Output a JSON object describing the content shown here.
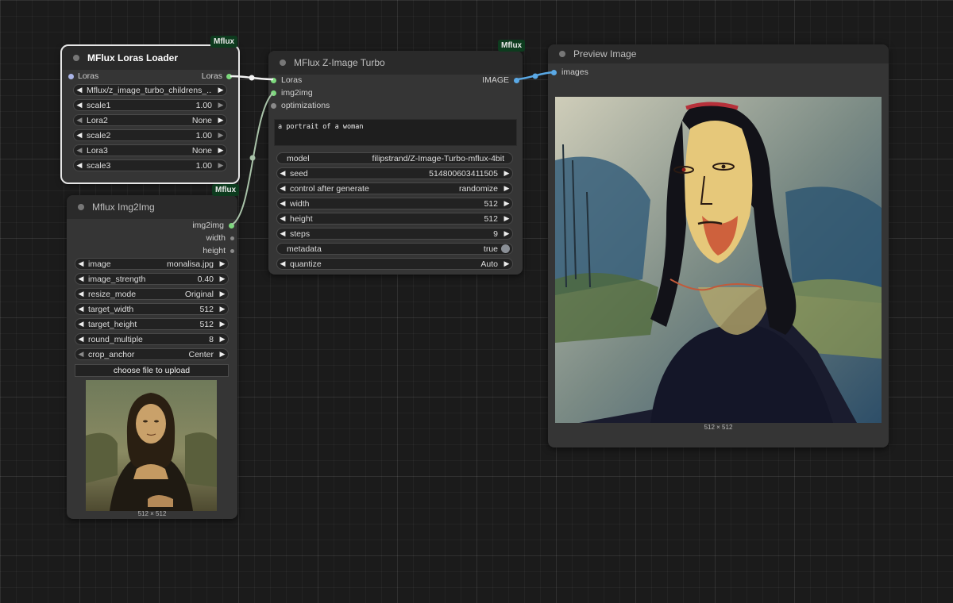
{
  "nodes": {
    "loras_loader": {
      "title": "MFlux Loras Loader",
      "badge": "Mflux",
      "badge_bottom": "Mflux",
      "input_label": "Loras",
      "output_label": "Loras",
      "widgets": [
        {
          "label": "Mflux/z_image_turbo_childrens_...",
          "value": ""
        },
        {
          "label": "scale1",
          "value": "1.00"
        },
        {
          "label": "Lora2",
          "value": "None"
        },
        {
          "label": "scale2",
          "value": "1.00"
        },
        {
          "label": "Lora3",
          "value": "None"
        },
        {
          "label": "scale3",
          "value": "1.00"
        }
      ]
    },
    "img2img": {
      "title": "Mflux Img2Img",
      "outputs": [
        "img2img",
        "width",
        "height"
      ],
      "widgets": [
        {
          "label": "image",
          "value": "monalisa.jpg"
        },
        {
          "label": "image_strength",
          "value": "0.40"
        },
        {
          "label": "resize_mode",
          "value": "Original"
        },
        {
          "label": "target_width",
          "value": "512"
        },
        {
          "label": "target_height",
          "value": "512"
        },
        {
          "label": "round_multiple",
          "value": "8"
        },
        {
          "label": "crop_anchor",
          "value": "Center"
        }
      ],
      "upload_button": "choose file to upload",
      "image_dims": "512 × 512"
    },
    "zimage": {
      "title": "MFlux Z-Image Turbo",
      "badge": "Mflux",
      "inputs": [
        "Loras",
        "img2img",
        "optimizations"
      ],
      "output_label": "IMAGE",
      "prompt": "a portrait of a woman",
      "model": {
        "label": "model",
        "value": "filipstrand/Z-Image-Turbo-mflux-4bit"
      },
      "widgets": [
        {
          "label": "seed",
          "value": "514800603411505"
        },
        {
          "label": "control after generate",
          "value": "randomize"
        },
        {
          "label": "width",
          "value": "512"
        },
        {
          "label": "height",
          "value": "512"
        },
        {
          "label": "steps",
          "value": "9"
        }
      ],
      "metadata": {
        "label": "metadata",
        "value": "true"
      },
      "quantize": {
        "label": "quantize",
        "value": "Auto"
      }
    },
    "preview": {
      "title": "Preview Image",
      "input_label": "images",
      "image_dims": "512 × 512"
    }
  },
  "colors": {
    "slot_green": "#7cd87c",
    "slot_blue": "#5aa9e6",
    "badge_bg": "#0d3b1e",
    "canvas_bg": "#1b1b1b"
  }
}
